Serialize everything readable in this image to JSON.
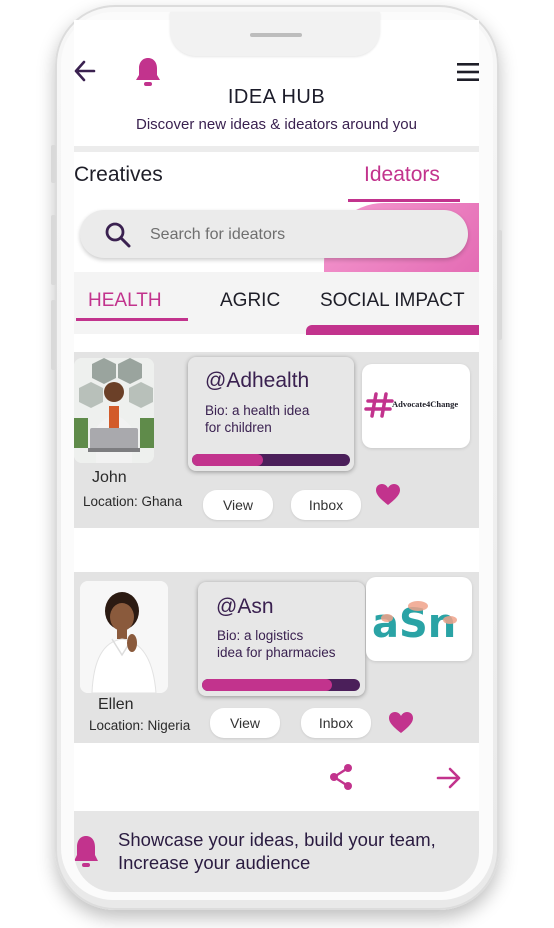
{
  "header": {
    "title": "IDEA HUB",
    "subtitle": "Discover new ideas & ideators around you",
    "icons": [
      "back-arrow-icon",
      "bell-icon",
      "menu-icon"
    ]
  },
  "tabs": [
    {
      "label": "Creatives",
      "active": false
    },
    {
      "label": "Ideators",
      "active": true
    }
  ],
  "search": {
    "placeholder": "Search for ideators"
  },
  "categories": [
    {
      "label": "HEALTH",
      "active": true
    },
    {
      "label": "AGRIC",
      "active": false
    },
    {
      "label": "SOCIAL IMPACT",
      "active": false
    }
  ],
  "cards": [
    {
      "name": "John",
      "location": "Location: Ghana",
      "handle": "@Adhealth",
      "bio": "Bio: a health idea\n for children",
      "progress": 0.45,
      "logo_text": "Advocate4Change",
      "view_label": "View",
      "inbox_label": "Inbox"
    },
    {
      "name": "Ellen",
      "location": "Location: Nigeria",
      "handle": "@Asn",
      "bio": "Bio: a logistics\nidea for pharmacies",
      "progress": 0.82,
      "logo_text": "aSn",
      "view_label": "View",
      "inbox_label": "Inbox"
    }
  ],
  "footer": {
    "text": "Showcase your ideas, build your team,\nIncrease your audience"
  },
  "colors": {
    "accent": "#c2338d",
    "dark_purple": "#4b1f5a",
    "teal": "#2aa3a5"
  }
}
